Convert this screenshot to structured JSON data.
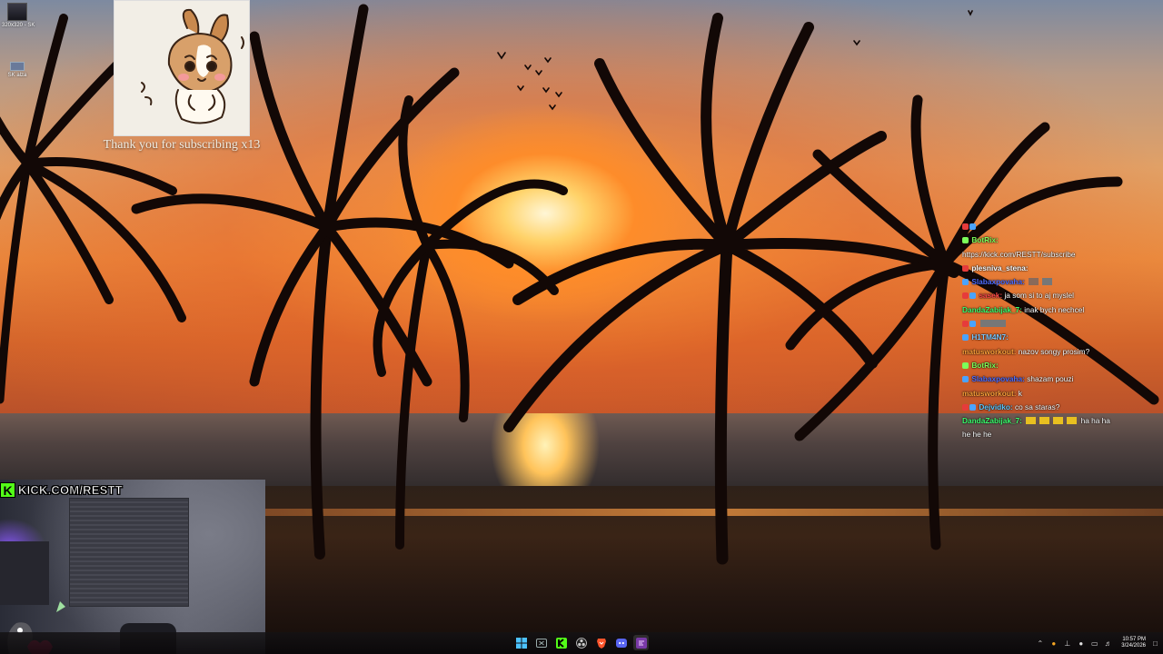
{
  "desktop": {
    "icons": [
      {
        "label": "320x320 - SK"
      },
      {
        "label": "SK alza"
      }
    ]
  },
  "alert": {
    "message": "Thank you for subscribing x13"
  },
  "chat": {
    "messages": [
      {
        "user": "",
        "text": "",
        "user_color": "#ff3b3b"
      },
      {
        "user": "BotRix:",
        "text": "",
        "user_color": "#7cff5a"
      },
      {
        "user": "",
        "text": "https://kick.com/RESTT/subscribe",
        "user_color": "#ffffff"
      },
      {
        "user": "plesniva_stena:",
        "text": "",
        "user_color": "#ffffff"
      },
      {
        "user": "Slabaxpovaha:",
        "text": "",
        "user_color": "#4f6dff"
      },
      {
        "user": "sasek:",
        "text": "ja som si to aj myslel",
        "user_color": "#ff4a4a"
      },
      {
        "user": "DandaZabijak_7:",
        "text": "inak bych nechcel",
        "user_color": "#3cff6e"
      },
      {
        "user": "",
        "text": "",
        "user_color": "#ff4a4a"
      },
      {
        "user": "H1TM4N7:",
        "text": "",
        "user_color": "#7cc8ff"
      },
      {
        "user": "matusworkout:",
        "text": "nazov songy prosim?",
        "user_color": "#ffa23a"
      },
      {
        "user": "BotRix:",
        "text": "",
        "user_color": "#7cff5a"
      },
      {
        "user": "Slabaxpovaha:",
        "text": "shazam pouzi",
        "user_color": "#4f6dff"
      },
      {
        "user": "matusworkout:",
        "text": "k",
        "user_color": "#ffa23a"
      },
      {
        "user": "Dejvidko:",
        "text": "co sa staras?",
        "user_color": "#5ac8ff"
      },
      {
        "user": "DandaZabijak_7:",
        "text": "ha ha ha he he he",
        "user_color": "#3cff6e"
      }
    ]
  },
  "stream": {
    "kick_url": "KICK.COM/RESTT",
    "kick_logo": "K"
  },
  "taskbar": {
    "apps": [
      {
        "icon": "windows-start-icon"
      },
      {
        "icon": "xbox-icon"
      },
      {
        "icon": "kick-icon"
      },
      {
        "icon": "obs-icon"
      },
      {
        "icon": "brave-browser-icon"
      },
      {
        "icon": "discord-icon"
      },
      {
        "icon": "streamer-app-icon"
      }
    ],
    "time": "10:57 PM",
    "date": "3/24/2026"
  },
  "colors": {
    "kick_green": "#53fc18",
    "taskbar_bg": "#141214"
  }
}
